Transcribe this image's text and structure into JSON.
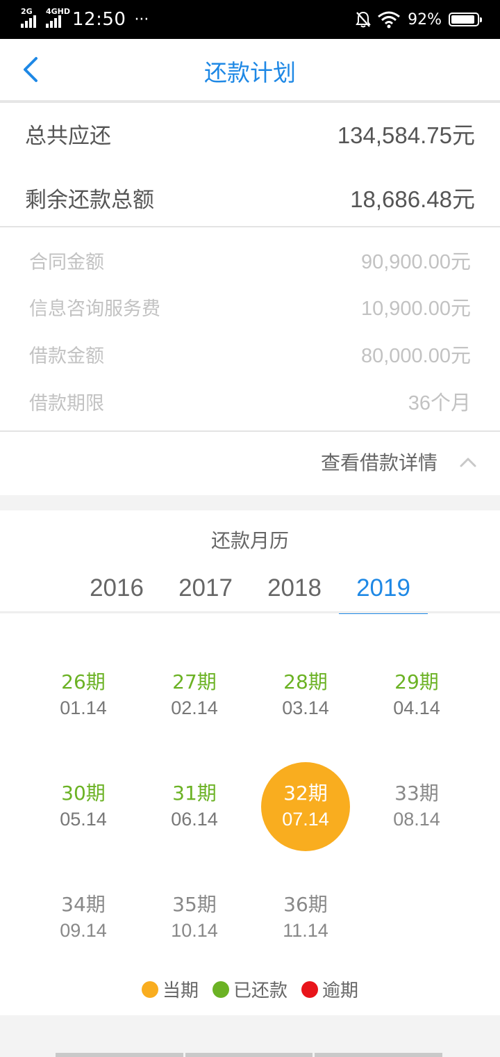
{
  "status_bar": {
    "sig1_label": "2G",
    "sig2_label": "4GHD",
    "time": "12:50",
    "dots": "···",
    "battery": "92%",
    "battery_level": 0.92
  },
  "header": {
    "title": "还款计划",
    "back_icon": "chevron-left-icon"
  },
  "summary": {
    "total_label": "总共应还",
    "total_value": "134,584.75元",
    "remaining_label": "剩余还款总额",
    "remaining_value": "18,686.48元"
  },
  "details": [
    {
      "label": "合同金额",
      "value": "90,900.00元"
    },
    {
      "label": "信息咨询服务费",
      "value": "10,900.00元"
    },
    {
      "label": "借款金额",
      "value": "80,000.00元"
    },
    {
      "label": "借款期限",
      "value": "36个月"
    }
  ],
  "details_toggle": {
    "label": "查看借款详情",
    "icon": "chevron-up-icon"
  },
  "calendar": {
    "title": "还款月历",
    "years": [
      "2016",
      "2017",
      "2018",
      "2019"
    ],
    "selected_year": "2019",
    "periods": [
      {
        "no": "26期",
        "date": "01.14",
        "status": "paid"
      },
      {
        "no": "27期",
        "date": "02.14",
        "status": "paid"
      },
      {
        "no": "28期",
        "date": "03.14",
        "status": "paid"
      },
      {
        "no": "29期",
        "date": "04.14",
        "status": "paid"
      },
      {
        "no": "30期",
        "date": "05.14",
        "status": "paid"
      },
      {
        "no": "31期",
        "date": "06.14",
        "status": "paid"
      },
      {
        "no": "32期",
        "date": "07.14",
        "status": "current"
      },
      {
        "no": "33期",
        "date": "08.14",
        "status": "pending"
      },
      {
        "no": "34期",
        "date": "09.14",
        "status": "pending"
      },
      {
        "no": "35期",
        "date": "10.14",
        "status": "pending"
      },
      {
        "no": "36期",
        "date": "11.14",
        "status": "pending"
      }
    ]
  },
  "legend": [
    {
      "label": "当期",
      "color": "#f9ad1f"
    },
    {
      "label": "已还款",
      "color": "#6bb224"
    },
    {
      "label": "逾期",
      "color": "#e8141a"
    }
  ],
  "colors": {
    "accent": "#1e88e5",
    "paid": "#6bb224",
    "current": "#f9ad1f",
    "overdue": "#e8141a"
  }
}
